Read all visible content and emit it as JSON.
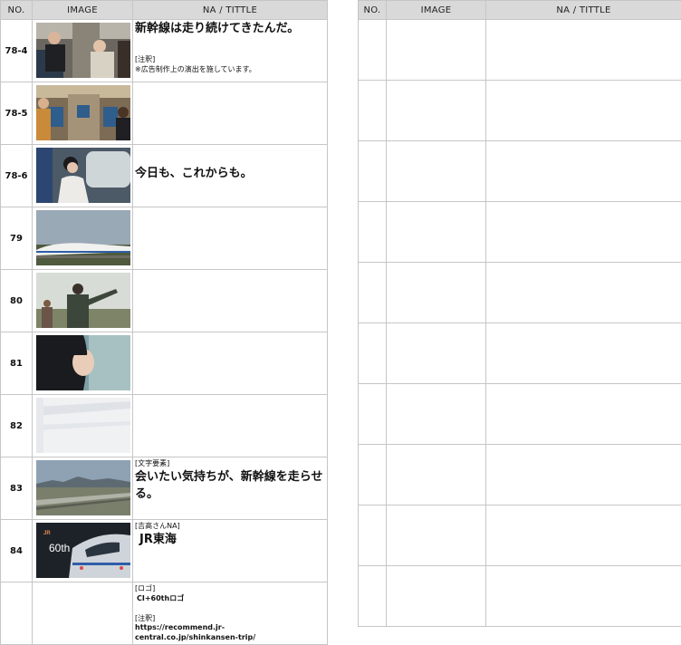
{
  "left": {
    "headers": {
      "no": "NO.",
      "image": "IMAGE",
      "na": "NA / TITTLE"
    },
    "rows": [
      {
        "no": "78-4",
        "na_main": "新幹線は走り続けてきたんだ。",
        "na_tag": "[注釈]",
        "na_note": "※広告制作上の演出を施しています。",
        "scene": "couple-on-train"
      },
      {
        "no": "78-5",
        "scene": "train-cabin-passengers"
      },
      {
        "no": "78-6",
        "na_main": "今日も、これからも。",
        "scene": "woman-window-seat"
      },
      {
        "no": "79",
        "scene": "shinkansen-landscape"
      },
      {
        "no": "80",
        "scene": "man-waving"
      },
      {
        "no": "81",
        "scene": "woman-smiling-profile"
      },
      {
        "no": "82",
        "scene": "white-blur"
      },
      {
        "no": "83",
        "na_tag": "[文字要素]",
        "na_main": "会いたい気持ちが、新幹線を走らせる。",
        "scene": "city-railway"
      },
      {
        "no": "84",
        "na_tag": "[吉高さんNA]",
        "na_main": "JR東海",
        "scene": "train-60th-logo",
        "logo_text": "60th"
      }
    ],
    "extra": {
      "logo_tag": "[ロゴ]",
      "logo_text": "CI+60thロゴ",
      "note_tag": "[注釈]",
      "note_url": "https://recommend.jr-central.co.jp/shinkansen-trip/"
    }
  },
  "right": {
    "headers": {
      "no": "NO.",
      "image": "IMAGE",
      "na": "NA / TITTLE"
    }
  }
}
